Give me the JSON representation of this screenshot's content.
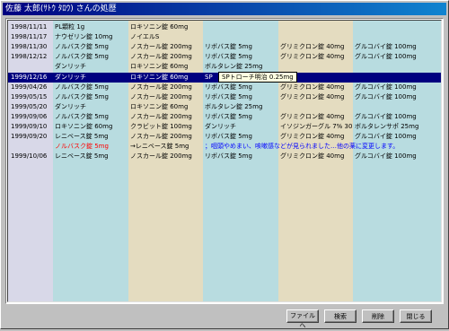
{
  "window": {
    "title": "佐藤 太郎(ｻﾄｳ ﾀﾛｳ) さんの処歴"
  },
  "colors": {
    "date_column": "#d8d8e8",
    "column_cyan": "#b8dce0",
    "column_beige": "#e4dcc0",
    "selected": "#000080",
    "note_text": "#0000ff",
    "changed_text": "#ff0000"
  },
  "rows": [
    {
      "date": "1998/11/11",
      "c1": "PL顆粒 1g",
      "c2": "ロキソニン錠 60mg",
      "c3": "",
      "c4": "",
      "c5": ""
    },
    {
      "date": "1998/11/17",
      "c1": "ナウゼリン錠 10mg",
      "c2": "ノイエルS",
      "c3": "",
      "c4": "",
      "c5": ""
    },
    {
      "date": "1998/11/30",
      "c1": "ノルバスク錠 5mg",
      "c2": "ノスカール錠 200mg",
      "c3": "リボバス錠 5mg",
      "c4": "グリミクロン錠 40mg",
      "c5": "グルコバイ錠 100mg"
    },
    {
      "date": "1998/12/12",
      "c1": "ノルバスク錠 5mg",
      "c2": "ノスカール錠 200mg",
      "c3": "リボバス錠 5mg",
      "c4": "グリミクロン錠 40mg",
      "c5": "グルコバイ錠 100mg"
    },
    {
      "date": "",
      "c1": "ダンリッチ",
      "c2": "ロキソニン錠 60mg",
      "c3": "ボルタレン錠 25mg",
      "c4": "",
      "c5": ""
    },
    {
      "date": "1999/12/16",
      "c1": "ダンリッチ",
      "c2": "ロキソニン錠 60mg",
      "c3": "SP",
      "c4": "",
      "c5": "",
      "selected": true
    },
    {
      "date": "1999/04/26",
      "c1": "ノルバスク錠 5mg",
      "c2": "ノスカール錠 200mg",
      "c3": "リボバス錠 5mg",
      "c4": "グリミクロン錠 40mg",
      "c5": "グルコバイ錠 100mg"
    },
    {
      "date": "1999/05/15",
      "c1": "ノルバスク錠 5mg",
      "c2": "ノスカール錠 200mg",
      "c3": "リボバス錠 5mg",
      "c4": "グリミクロン錠 40mg",
      "c5": "グルコバイ錠 100mg"
    },
    {
      "date": "1999/05/20",
      "c1": "ダンリッチ",
      "c2": "ロキソニン錠 60mg",
      "c3": "ボルタレン錠 25mg",
      "c4": "",
      "c5": ""
    },
    {
      "date": "1999/09/06",
      "c1": "ノルバスク錠 5mg",
      "c2": "ノスカール錠 200mg",
      "c3": "リボバス錠 5mg",
      "c4": "グリミクロン錠 40mg",
      "c5": "グルコバイ錠 100mg"
    },
    {
      "date": "1999/09/10",
      "c1": "ロキソニン錠 60mg",
      "c2": "クラビット錠 100mg",
      "c3": "ダンリッチ",
      "c4": "イソジンガーグル 7% 30ml",
      "c5": "ボルタレンサポ 25mg"
    },
    {
      "date": "1999/09/20",
      "c1": "レニベース錠 5mg",
      "c2": "ノスカール錠 200mg",
      "c3": "リボバス錠 5mg",
      "c4": "グリミクロン錠 40mg",
      "c5": "グルコバイ錠 100mg"
    },
    {
      "date": "",
      "c1": "ノルバスク錠 5mg",
      "c2": "→レニベース錠 5mg",
      "c3": "",
      "c4": "",
      "c5": "",
      "red": true,
      "note": "；咽頭やめまい、咳嗽感などが見られました…他の薬に変更します。"
    },
    {
      "date": "1999/10/06",
      "c1": "レニベース錠 5mg",
      "c2": "ノスカール錠 200mg",
      "c3": "リボバス錠 5mg",
      "c4": "グリミクロン錠 40mg",
      "c5": "グルコバイ錠 100mg"
    }
  ],
  "tooltip": {
    "text": "SPトローチ明治 0.25mg"
  },
  "buttons": {
    "file": "ファイルへ",
    "search": "検索",
    "delete": "削除",
    "close": "閉じる"
  }
}
